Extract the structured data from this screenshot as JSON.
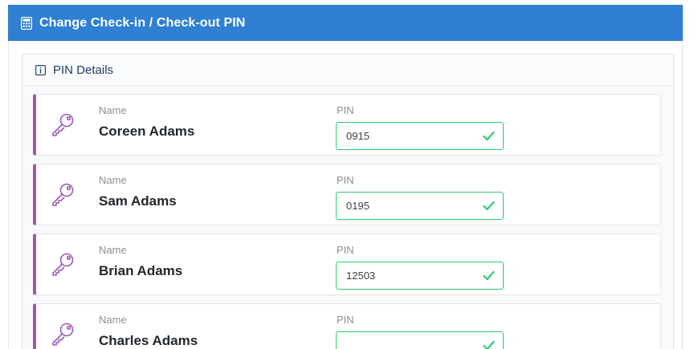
{
  "header": {
    "title": "Change Check-in / Check-out PIN",
    "icon": "calculator-icon",
    "background_color": "#2f7fd2"
  },
  "details": {
    "title": "PIN Details",
    "icon": "info-icon"
  },
  "rows": [
    {
      "name_label": "Name",
      "name": "Coreen Adams",
      "pin_label": "PIN",
      "pin": "0915",
      "icon": "key-icon",
      "status": "valid"
    },
    {
      "name_label": "Name",
      "name": "Sam Adams",
      "pin_label": "PIN",
      "pin": "0195",
      "icon": "key-icon",
      "status": "valid"
    },
    {
      "name_label": "Name",
      "name": "Brian Adams",
      "pin_label": "PIN",
      "pin": "12503",
      "icon": "key-icon",
      "status": "valid"
    },
    {
      "name_label": "Name",
      "name": "Charles Adams",
      "pin_label": "PIN",
      "pin": "",
      "icon": "key-icon",
      "status": "valid"
    }
  ],
  "colors": {
    "accent_purple": "#9b59b6",
    "valid_green": "#2ecc71"
  }
}
